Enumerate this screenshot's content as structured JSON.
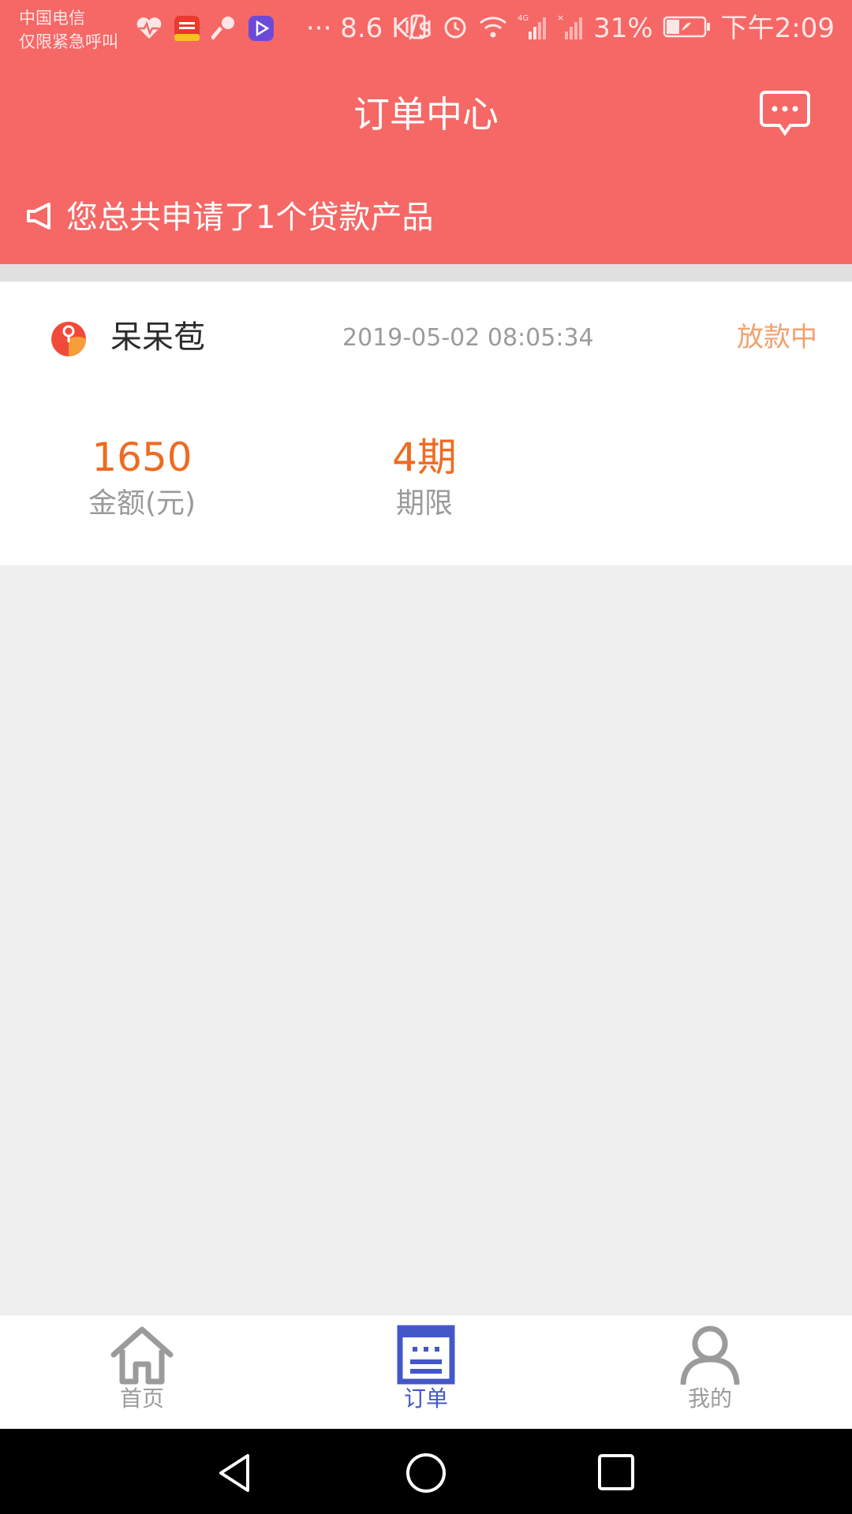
{
  "status_bar": {
    "carrier_line1": "中国电信",
    "carrier_line2": "仅限紧急呼叫",
    "net_speed": "··· 8.6 K/s",
    "battery_percent": "31%",
    "time": "下午2:09"
  },
  "header": {
    "title": "订单中心",
    "message_icon": "chat-bubble-icon"
  },
  "notice": {
    "icon": "megaphone-icon",
    "text": "您总共申请了1个贷款产品"
  },
  "order": {
    "product_name": "呆呆苞",
    "time": "2019-05-02 08:05:34",
    "status": "放款中",
    "amount_value": "1650",
    "amount_label": "金额(元)",
    "term_value": "4期",
    "term_label": "期限"
  },
  "tabbar": {
    "tabs": [
      {
        "label": "首页",
        "icon": "home-icon",
        "active": false
      },
      {
        "label": "订单",
        "icon": "order-icon",
        "active": true
      },
      {
        "label": "我的",
        "icon": "profile-icon",
        "active": false
      }
    ]
  },
  "colors": {
    "header_bg": "#f56866",
    "accent_orange": "#ee6b21",
    "status_orange": "#f3a06c",
    "active_tab": "#4457c8"
  }
}
